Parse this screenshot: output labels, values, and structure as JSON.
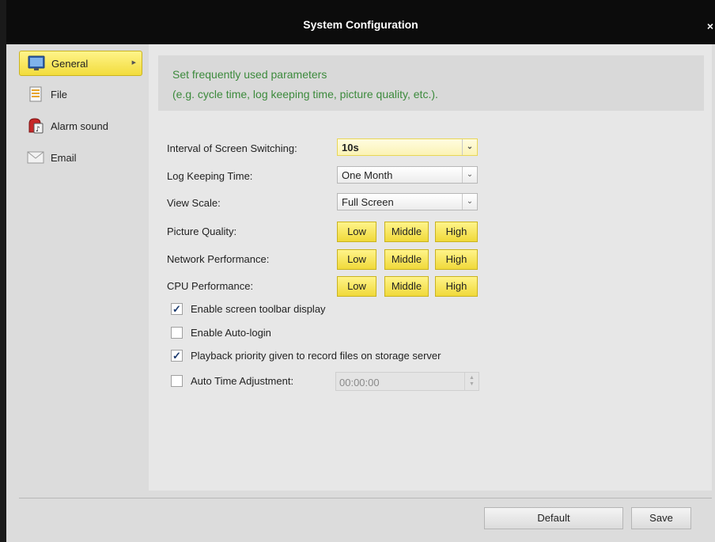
{
  "window": {
    "title": "System Configuration",
    "close_glyph": "×"
  },
  "sidebar": {
    "items": [
      {
        "label": "General",
        "icon": "monitor-icon",
        "active": true
      },
      {
        "label": "File",
        "icon": "file-icon",
        "active": false
      },
      {
        "label": "Alarm sound",
        "icon": "alarm-icon",
        "active": false
      },
      {
        "label": "Email",
        "icon": "envelope-icon",
        "active": false
      }
    ]
  },
  "info": {
    "line1": "Set frequently used parameters",
    "line2": "(e.g. cycle time, log keeping time, picture quality, etc.)."
  },
  "settings": {
    "interval": {
      "label": "Interval of Screen Switching:",
      "value": "10s"
    },
    "log": {
      "label": "Log Keeping Time:",
      "value": "One Month"
    },
    "scale": {
      "label": "View Scale:",
      "value": "Full Screen"
    },
    "picture": {
      "label": "Picture Quality:"
    },
    "network": {
      "label": "Network Performance:"
    },
    "cpu": {
      "label": "CPU Performance:"
    },
    "quality_options": [
      "Low",
      "Middle",
      "High"
    ]
  },
  "checkboxes": {
    "toolbar": {
      "label": "Enable screen toolbar display",
      "checked": true
    },
    "autologin": {
      "label": "Enable Auto-login",
      "checked": false
    },
    "playback": {
      "label": "Playback priority given to record files on storage server",
      "checked": true
    },
    "autotime": {
      "label": "Auto Time Adjustment:",
      "checked": false,
      "time_value": "00:00:00"
    }
  },
  "footer": {
    "default_label": "Default",
    "save_label": "Save"
  },
  "colors": {
    "accent": "#f2dc3c",
    "info_text": "#3c8a3c",
    "titlebar": "#0c0c0c"
  }
}
